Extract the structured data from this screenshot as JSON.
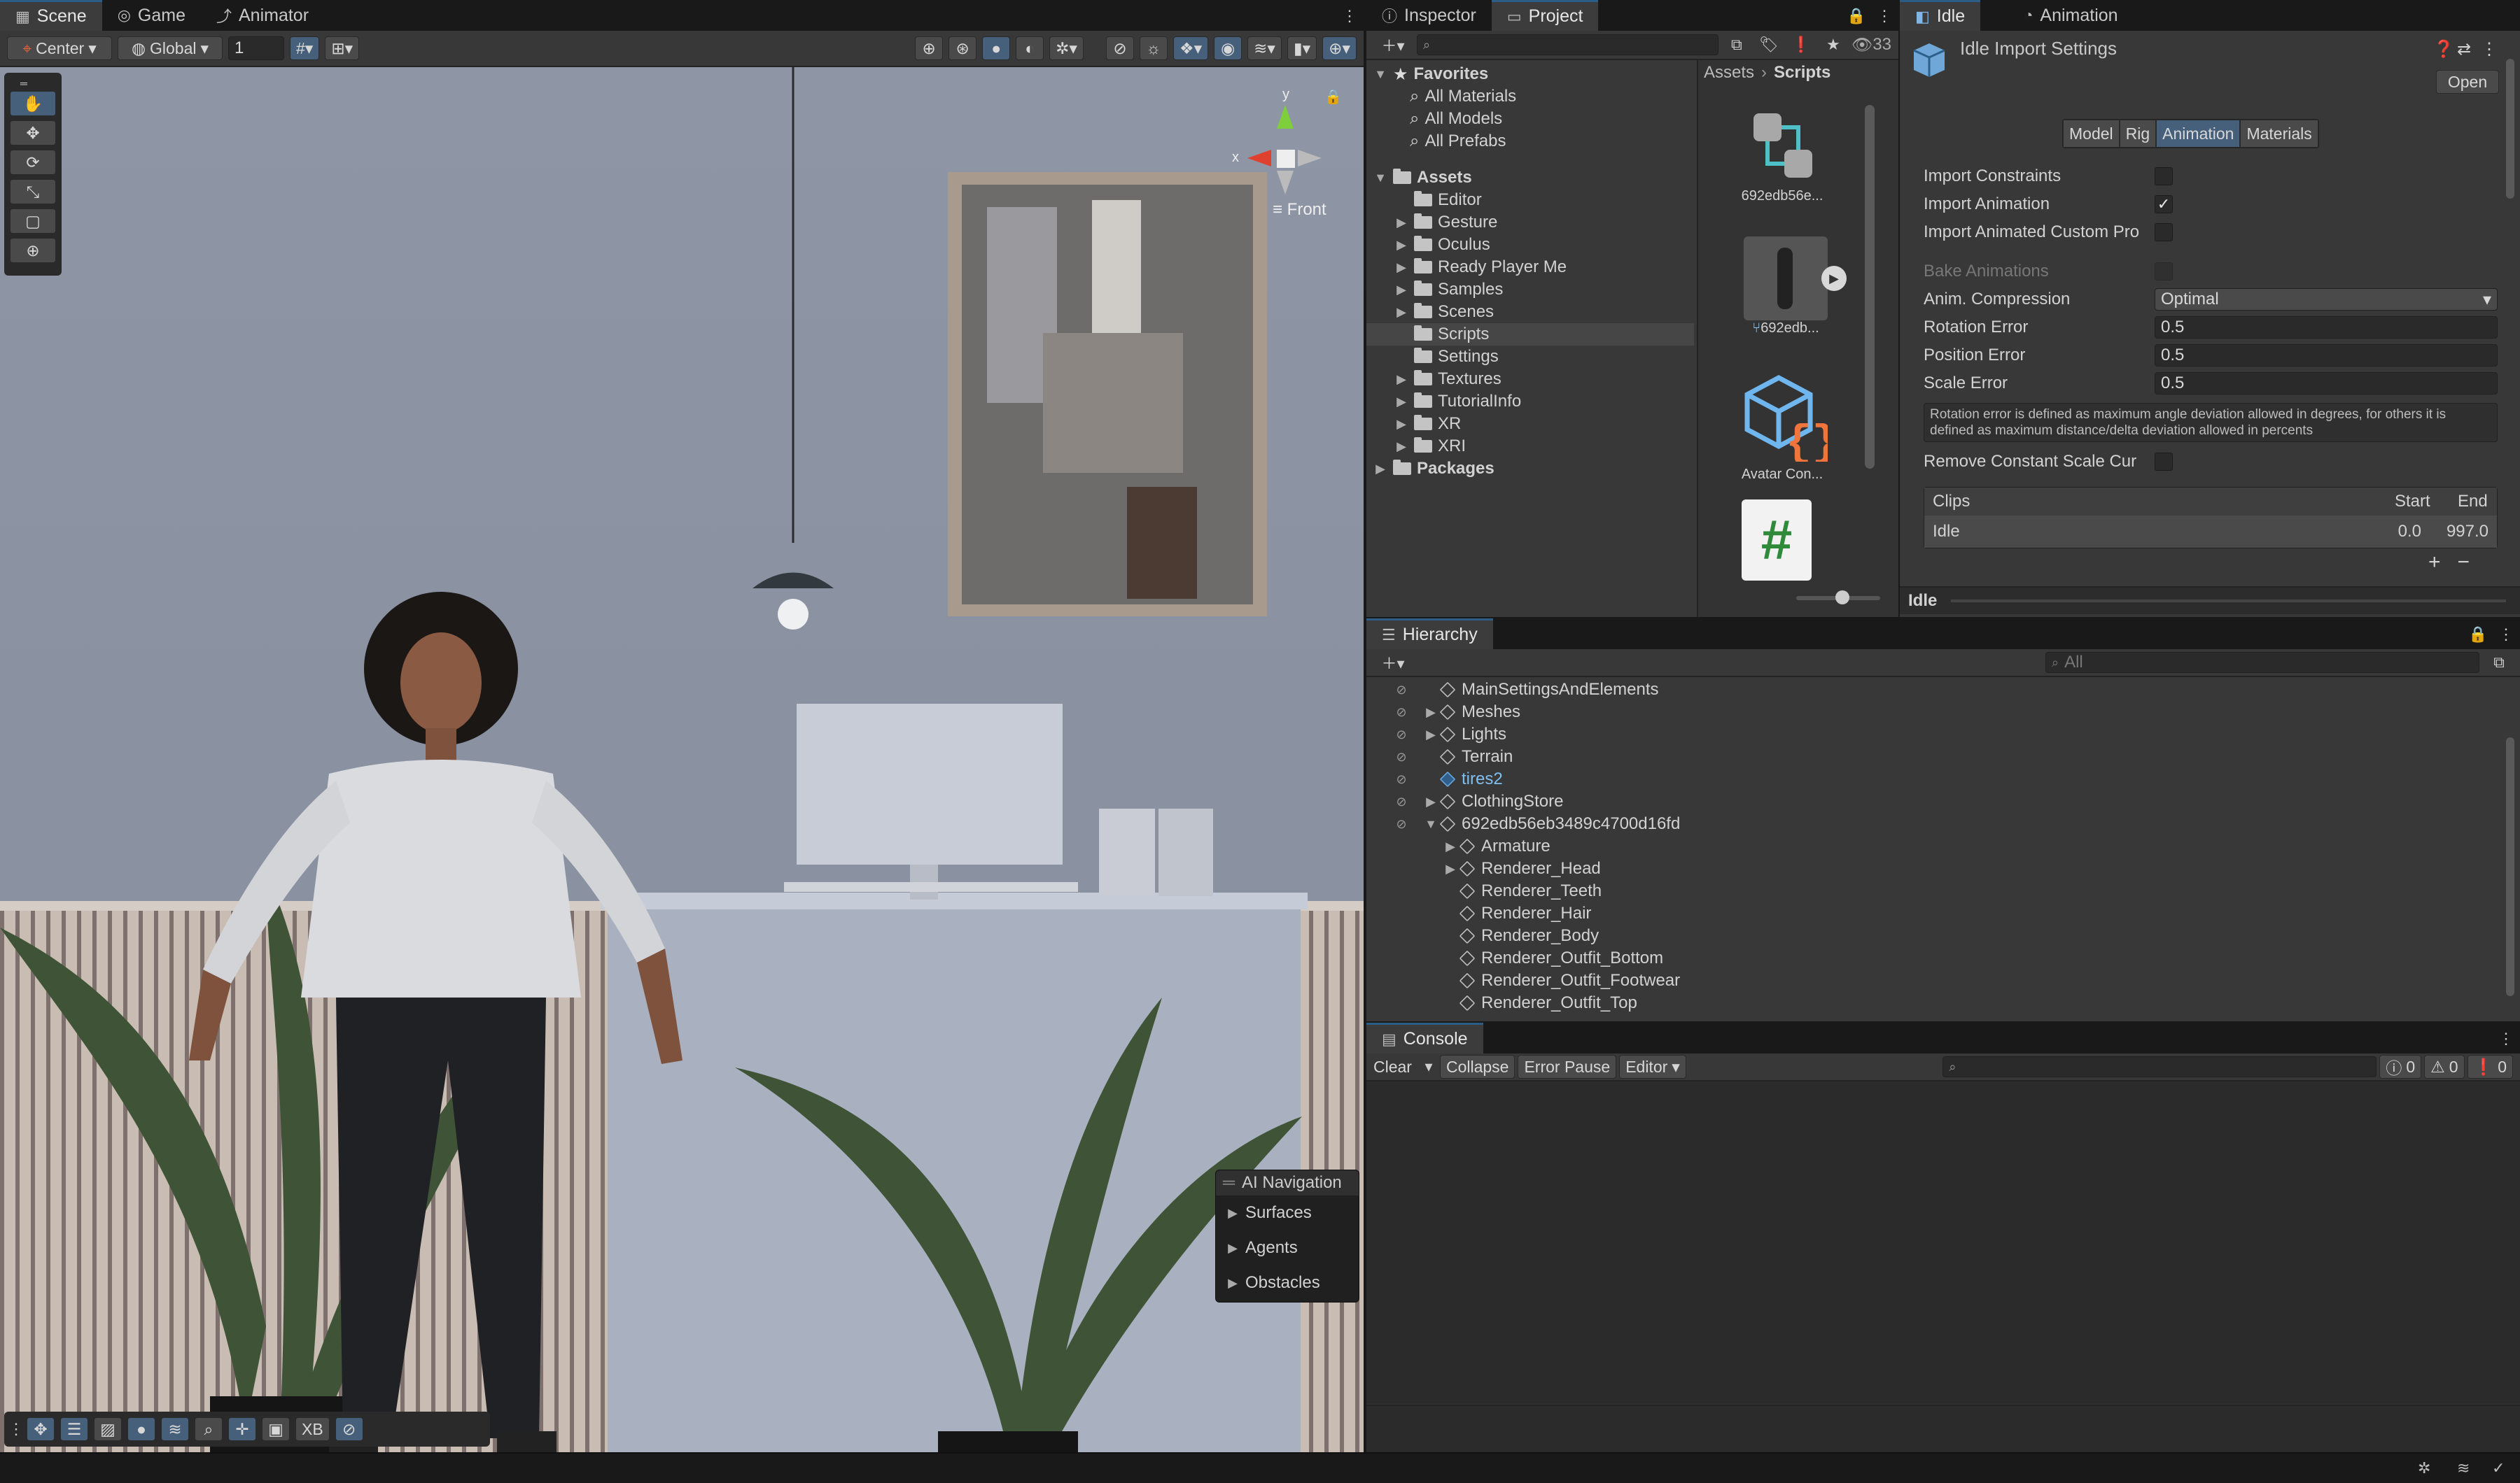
{
  "scene_panel": {
    "tabs": [
      {
        "label": "Scene",
        "icon": "grid-icon"
      },
      {
        "label": "Game",
        "icon": "gamepad-icon"
      },
      {
        "label": "Animator",
        "icon": "animator-icon"
      }
    ],
    "toolbar": {
      "pivot": "Center",
      "space": "Global",
      "snap_value": "1"
    },
    "gizmo": {
      "x_label": "x",
      "y_label": "y",
      "view_label": "Front"
    },
    "ai_navigation": {
      "title": "AI Navigation",
      "items": [
        "Surfaces",
        "Agents",
        "Obstacles"
      ]
    },
    "bottom_tools": {
      "xb_label": "XB"
    }
  },
  "project_panel": {
    "tabs": [
      {
        "label": "Inspector",
        "icon": "info-icon"
      },
      {
        "label": "Project",
        "icon": "folder-icon"
      }
    ],
    "hidden_count": "33",
    "favorites": {
      "label": "Favorites",
      "items": [
        "All Materials",
        "All Models",
        "All Prefabs"
      ]
    },
    "assets": {
      "label": "Assets",
      "items": [
        {
          "label": "Editor",
          "expandable": false
        },
        {
          "label": "Gesture",
          "expandable": true
        },
        {
          "label": "Oculus",
          "expandable": true
        },
        {
          "label": "Ready Player Me",
          "expandable": true
        },
        {
          "label": "Samples",
          "expandable": true
        },
        {
          "label": "Scenes",
          "expandable": true
        },
        {
          "label": "Scripts",
          "expandable": false,
          "selected": true
        },
        {
          "label": "Settings",
          "expandable": false
        },
        {
          "label": "Textures",
          "expandable": true
        },
        {
          "label": "TutorialInfo",
          "expandable": true
        },
        {
          "label": "XR",
          "expandable": true
        },
        {
          "label": "XRI",
          "expandable": true
        }
      ]
    },
    "packages_label": "Packages",
    "breadcrumb": {
      "root": "Assets",
      "current": "Scripts"
    },
    "grid_items": [
      {
        "label": "692edb56e...",
        "icon": "blend-tree-icon"
      },
      {
        "label": "692edb...",
        "icon": "model-preview-icon"
      },
      {
        "label": "Avatar Con...",
        "icon": "script-cube-icon"
      },
      {
        "label": "",
        "icon": "csharp-script-icon"
      }
    ]
  },
  "inspector": {
    "tabs": [
      {
        "label": "Idle",
        "icon": "cube-icon"
      },
      {
        "label": "Animation",
        "icon": "clock-icon"
      }
    ],
    "title": "Idle Import Settings",
    "open_label": "Open",
    "sub_tabs": [
      {
        "label": "Model",
        "active": false
      },
      {
        "label": "Rig",
        "active": false
      },
      {
        "label": "Animation",
        "active": true
      },
      {
        "label": "Materials",
        "active": false
      }
    ],
    "import_constraints": {
      "label": "Import Constraints",
      "checked": false
    },
    "import_animation": {
      "label": "Import Animation",
      "checked": true
    },
    "import_animated_custom": {
      "label": "Import Animated Custom Pro",
      "checked": false
    },
    "bake_animations": {
      "label": "Bake Animations",
      "checked": false
    },
    "anim_compression": {
      "label": "Anim. Compression",
      "value": "Optimal"
    },
    "rotation_error": {
      "label": "Rotation Error",
      "value": "0.5"
    },
    "position_error": {
      "label": "Position Error",
      "value": "0.5"
    },
    "scale_error": {
      "label": "Scale Error",
      "value": "0.5"
    },
    "help_text": "Rotation error is defined as maximum angle deviation allowed in degrees, for others it is defined as maximum distance/delta deviation allowed in percents",
    "remove_constant_scale": {
      "label": "Remove Constant Scale Cur",
      "checked": false
    },
    "clips": {
      "header": "Clips",
      "start_label": "Start",
      "end_label": "End",
      "rows": [
        {
          "name": "Idle",
          "start": "0.0",
          "end": "997.0"
        }
      ]
    },
    "preview_label": "Idle"
  },
  "hierarchy": {
    "tab_label": "Hierarchy",
    "search_placeholder": "All",
    "items": [
      {
        "label": "MainSettingsAndElements",
        "depth": 0,
        "arrow": "",
        "highlight": false
      },
      {
        "label": "Meshes",
        "depth": 0,
        "arrow": "▶",
        "highlight": false
      },
      {
        "label": "Lights",
        "depth": 0,
        "arrow": "▶",
        "highlight": false
      },
      {
        "label": "Terrain",
        "depth": 0,
        "arrow": "",
        "highlight": false
      },
      {
        "label": "tires2",
        "depth": 0,
        "arrow": "",
        "highlight": true
      },
      {
        "label": "ClothingStore",
        "depth": 0,
        "arrow": "▶",
        "highlight": false
      },
      {
        "label": "692edb56eb3489c4700d16fd",
        "depth": 0,
        "arrow": "▼",
        "highlight": false
      },
      {
        "label": "Armature",
        "depth": 1,
        "arrow": "▶",
        "highlight": false
      },
      {
        "label": "Renderer_Head",
        "depth": 1,
        "arrow": "▶",
        "highlight": false
      },
      {
        "label": "Renderer_Teeth",
        "depth": 1,
        "arrow": "",
        "highlight": false
      },
      {
        "label": "Renderer_Hair",
        "depth": 1,
        "arrow": "",
        "highlight": false
      },
      {
        "label": "Renderer_Body",
        "depth": 1,
        "arrow": "",
        "highlight": false
      },
      {
        "label": "Renderer_Outfit_Bottom",
        "depth": 1,
        "arrow": "",
        "highlight": false
      },
      {
        "label": "Renderer_Outfit_Footwear",
        "depth": 1,
        "arrow": "",
        "highlight": false
      },
      {
        "label": "Renderer_Outfit_Top",
        "depth": 1,
        "arrow": "",
        "highlight": false
      }
    ]
  },
  "console": {
    "tab_label": "Console",
    "clear_label": "Clear",
    "collapse_label": "Collapse",
    "error_pause_label": "Error Pause",
    "editor_label": "Editor",
    "info_count": "0",
    "warning_count": "0",
    "error_count": "0"
  },
  "colors": {
    "accent": "#2c5d87",
    "selection": "#2c5d87",
    "panel": "#383838",
    "highlight_text": "#7fbff0"
  }
}
